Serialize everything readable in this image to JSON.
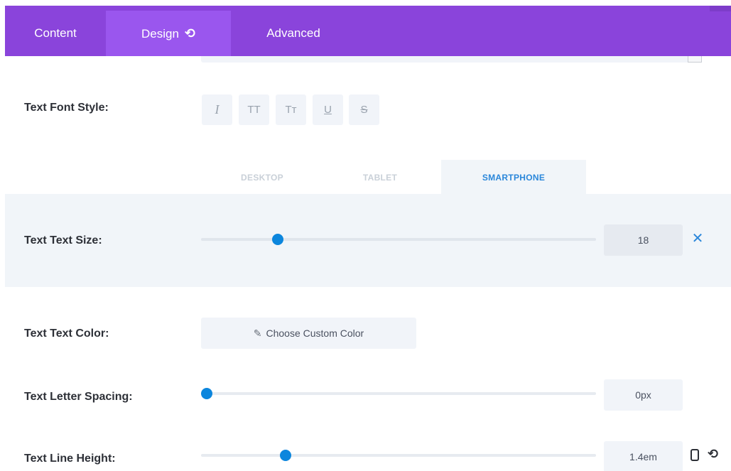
{
  "tabs": {
    "content": "Content",
    "design": "Design",
    "design_icon": "undo-icon",
    "advanced": "Advanced"
  },
  "font_style": {
    "label": "Text Font Style:",
    "buttons": [
      {
        "name": "italic",
        "glyph": "I"
      },
      {
        "name": "uppercase",
        "glyph": "TT"
      },
      {
        "name": "small-caps",
        "glyph": "Tт"
      },
      {
        "name": "underline",
        "glyph": "U"
      },
      {
        "name": "strikethrough",
        "glyph": "S"
      }
    ]
  },
  "device_tabs": {
    "desktop": "DESKTOP",
    "tablet": "TABLET",
    "smartphone": "SMARTPHONE",
    "active": "smartphone"
  },
  "text_size": {
    "label": "Text Text Size:",
    "value": "18",
    "slider_fraction": 0.18
  },
  "text_color": {
    "label": "Text Text Color:",
    "button": "Choose Custom Color"
  },
  "letter_spacing": {
    "label": "Text Letter Spacing:",
    "value": "0px",
    "slider_fraction": 0.0
  },
  "line_height": {
    "label": "Text Line Height:",
    "value": "1.4em",
    "slider_fraction": 0.2
  },
  "colors": {
    "tab_bar": "#8a44db",
    "tab_active": "#9a56ee",
    "accent": "#2b87da",
    "slider_thumb": "#0c86dd",
    "panel_bg": "#f1f5f9"
  }
}
